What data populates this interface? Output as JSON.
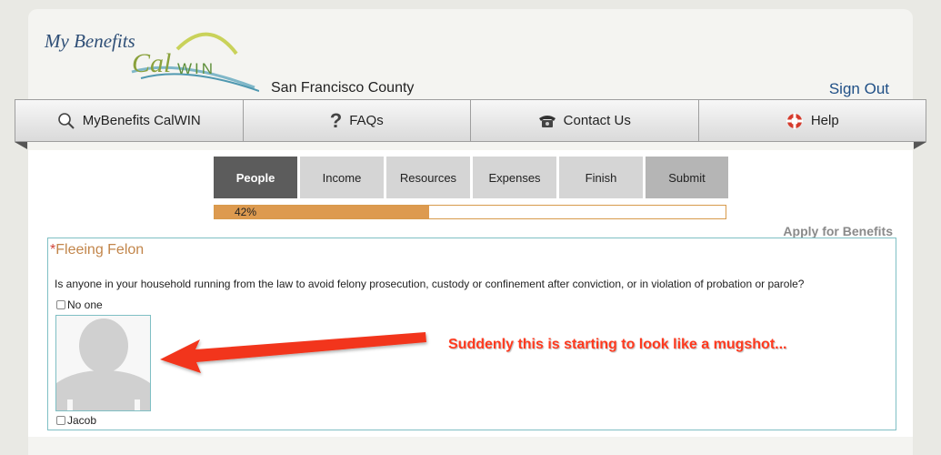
{
  "header": {
    "logo_text_1": "My Benefits",
    "logo_text_2": "Cal",
    "logo_text_3": "WIN",
    "county": "San Francisco County",
    "sign_out": "Sign Out"
  },
  "nav": {
    "items": [
      {
        "label": "MyBenefits CalWIN",
        "icon": "search-icon"
      },
      {
        "label": "FAQs",
        "icon": "question-icon"
      },
      {
        "label": "Contact Us",
        "icon": "phone-icon"
      },
      {
        "label": "Help",
        "icon": "lifebuoy-icon"
      }
    ]
  },
  "steps": [
    {
      "label": "People",
      "active": true
    },
    {
      "label": "Income"
    },
    {
      "label": "Resources"
    },
    {
      "label": "Expenses"
    },
    {
      "label": "Finish"
    },
    {
      "label": "Submit"
    }
  ],
  "progress": {
    "label": "42%",
    "value": 0.42
  },
  "apply_label": "Apply for Benefits",
  "panel": {
    "required_mark": "*",
    "title": "Fleeing Felon",
    "question": "Is anyone in your household running from the law to avoid felony prosecution, custody or confinement after conviction, or in violation of probation or parole?",
    "no_one_label": "No one",
    "person_label": "Jacob"
  },
  "annotation": "Suddenly this is starting to look like a mugshot...",
  "colors": {
    "accent_orange": "#dd9a4f",
    "annotation_red": "#ff3a1f",
    "link_blue": "#1f4f86",
    "panel_border": "#7fbfc4"
  }
}
